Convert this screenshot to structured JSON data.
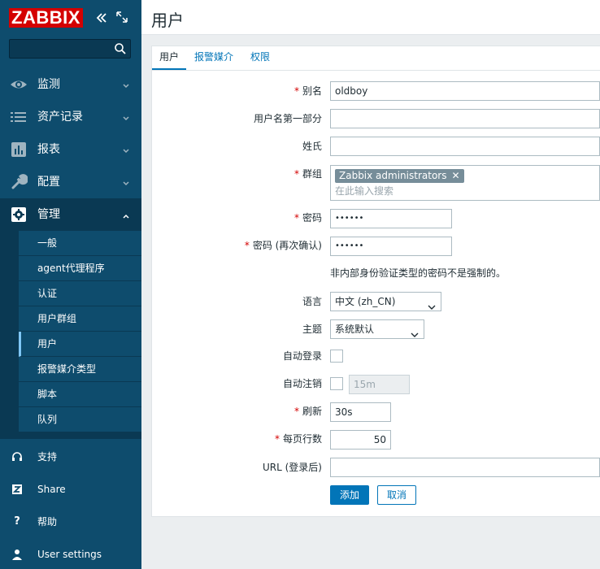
{
  "brand": {
    "logo": "ZABBIX"
  },
  "sidebar": {
    "search_placeholder": "",
    "menu": [
      {
        "label": "监测",
        "icon": "eye-icon"
      },
      {
        "label": "资产记录",
        "icon": "list-icon"
      },
      {
        "label": "报表",
        "icon": "bar-chart-icon"
      },
      {
        "label": "配置",
        "icon": "wrench-icon"
      },
      {
        "label": "管理",
        "icon": "gear-icon"
      }
    ],
    "submenu": [
      "一般",
      "agent代理程序",
      "认证",
      "用户群组",
      "用户",
      "报警媒介类型",
      "脚本",
      "队列"
    ],
    "bottom": [
      {
        "label": "支持",
        "icon": "headset-icon"
      },
      {
        "label": "Share",
        "icon": "z-icon"
      },
      {
        "label": "帮助",
        "icon": "question-icon"
      },
      {
        "label": "User settings",
        "icon": "user-icon"
      }
    ]
  },
  "page": {
    "title": "用户"
  },
  "tabs": [
    "用户",
    "报警媒介",
    "权限"
  ],
  "form": {
    "alias_label": "别名",
    "alias_value": "oldboy",
    "name_label": "用户名第一部分",
    "name_value": "",
    "surname_label": "姓氏",
    "surname_value": "",
    "groups_label": "群组",
    "groups_chip": "Zabbix administrators",
    "groups_placeholder": "在此输入搜索",
    "password_label": "密码",
    "password_value": "••••••",
    "password2_label": "密码 (再次确认)",
    "password2_value": "••••••",
    "password_hint": "非内部身份验证类型的密码不是强制的。",
    "lang_label": "语言",
    "lang_value": "中文 (zh_CN)",
    "theme_label": "主题",
    "theme_value": "系统默认",
    "autologin_label": "自动登录",
    "autologout_label": "自动注销",
    "autologout_value": "15m",
    "refresh_label": "刷新",
    "refresh_value": "30s",
    "rows_label": "每页行数",
    "rows_value": "50",
    "url_label": "URL (登录后)",
    "url_value": "",
    "add_button": "添加",
    "cancel_button": "取消"
  }
}
